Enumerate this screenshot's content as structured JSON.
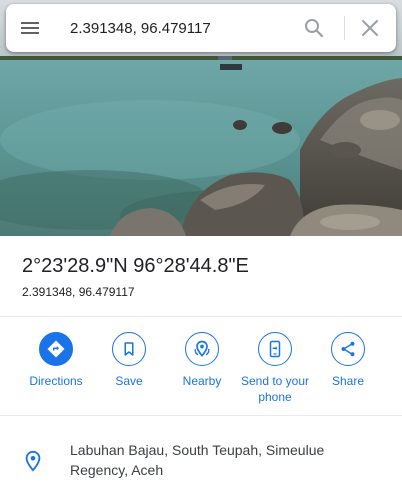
{
  "search": {
    "value": "2.391348, 96.479117"
  },
  "place": {
    "title": "2°23'28.9\"N 96°28'44.8\"E",
    "subtitle": "2.391348, 96.479117"
  },
  "actions": [
    {
      "label": "Directions",
      "icon": "directions-icon"
    },
    {
      "label": "Save",
      "icon": "bookmark-icon"
    },
    {
      "label": "Nearby",
      "icon": "nearby-icon"
    },
    {
      "label": "Send to your phone",
      "icon": "phone-icon"
    },
    {
      "label": "Share",
      "icon": "share-icon"
    }
  ],
  "address": {
    "text": "Labuhan Bajau, South Teupah, Simeulue Regency, Aceh",
    "icon": "location-pin-icon"
  },
  "colors": {
    "accent": "#1a73e8",
    "text_primary": "#202124",
    "icon_grey": "#5f6368"
  }
}
